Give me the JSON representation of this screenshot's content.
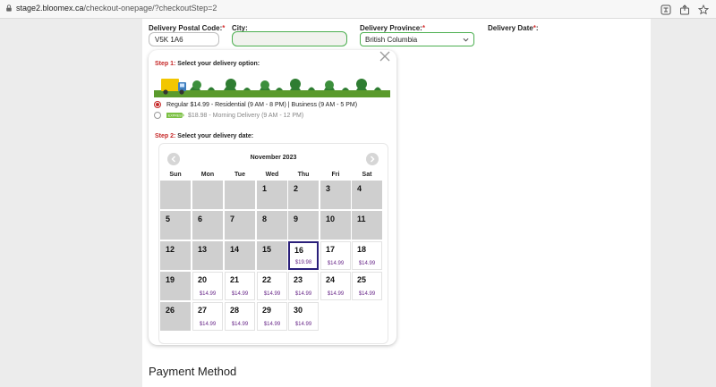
{
  "browser": {
    "url_host": "stage2.bloomex.ca",
    "url_path": "/checkout-onepage/?checkoutStep=2"
  },
  "form": {
    "postal_label": "Delivery Postal Code:",
    "postal_value": "V5K 1A6",
    "city_label": "City:",
    "city_value": "",
    "province_label": "Delivery Province:",
    "province_value": "British Columbia",
    "date_label": "Delivery Date",
    "required_mark": "*",
    "colon": ":"
  },
  "popup": {
    "step1_num": "Step 1:",
    "step1_text": "Select your delivery option:",
    "option_regular": "Regular $14.99 - Residential (9 AM - 8 PM) | Business (9 AM - 5 PM)",
    "option_morning": "$18.98 - Morning Delivery (9 AM - 12 PM)",
    "express_label": "EXPRESS",
    "step2_num": "Step 2:",
    "step2_text": "Select your delivery date:"
  },
  "calendar": {
    "month": "November 2023",
    "weekdays": [
      "Sun",
      "Mon",
      "Tue",
      "Wed",
      "Thu",
      "Fri",
      "Sat"
    ],
    "weeks": [
      [
        {
          "n": "",
          "p": ""
        },
        {
          "n": "",
          "p": ""
        },
        {
          "n": "",
          "p": ""
        },
        {
          "n": "1",
          "p": ""
        },
        {
          "n": "2",
          "p": ""
        },
        {
          "n": "3",
          "p": ""
        },
        {
          "n": "4",
          "p": ""
        }
      ],
      [
        {
          "n": "5",
          "p": ""
        },
        {
          "n": "6",
          "p": ""
        },
        {
          "n": "7",
          "p": ""
        },
        {
          "n": "8",
          "p": ""
        },
        {
          "n": "9",
          "p": ""
        },
        {
          "n": "10",
          "p": ""
        },
        {
          "n": "11",
          "p": ""
        }
      ],
      [
        {
          "n": "12",
          "p": ""
        },
        {
          "n": "13",
          "p": ""
        },
        {
          "n": "14",
          "p": ""
        },
        {
          "n": "15",
          "p": ""
        },
        {
          "n": "16",
          "p": "$19.98"
        },
        {
          "n": "17",
          "p": "$14.99"
        },
        {
          "n": "18",
          "p": "$14.99"
        }
      ],
      [
        {
          "n": "19",
          "p": ""
        },
        {
          "n": "20",
          "p": "$14.99"
        },
        {
          "n": "21",
          "p": "$14.99"
        },
        {
          "n": "22",
          "p": "$14.99"
        },
        {
          "n": "23",
          "p": "$14.99"
        },
        {
          "n": "24",
          "p": "$14.99"
        },
        {
          "n": "25",
          "p": "$14.99"
        }
      ],
      [
        {
          "n": "26",
          "p": ""
        },
        {
          "n": "27",
          "p": "$14.99"
        },
        {
          "n": "28",
          "p": "$14.99"
        },
        {
          "n": "29",
          "p": "$14.99"
        },
        {
          "n": "30",
          "p": "$14.99"
        },
        null,
        null
      ]
    ],
    "selected_day": "16"
  },
  "payment_title": "Payment Method",
  "colors": {
    "accent_red": "#c62828",
    "available_green": "#4caf50",
    "selected_border": "#2a1f7a",
    "price_purple": "#6a2a8a",
    "unavailable_gray": "#cfcfcf"
  }
}
